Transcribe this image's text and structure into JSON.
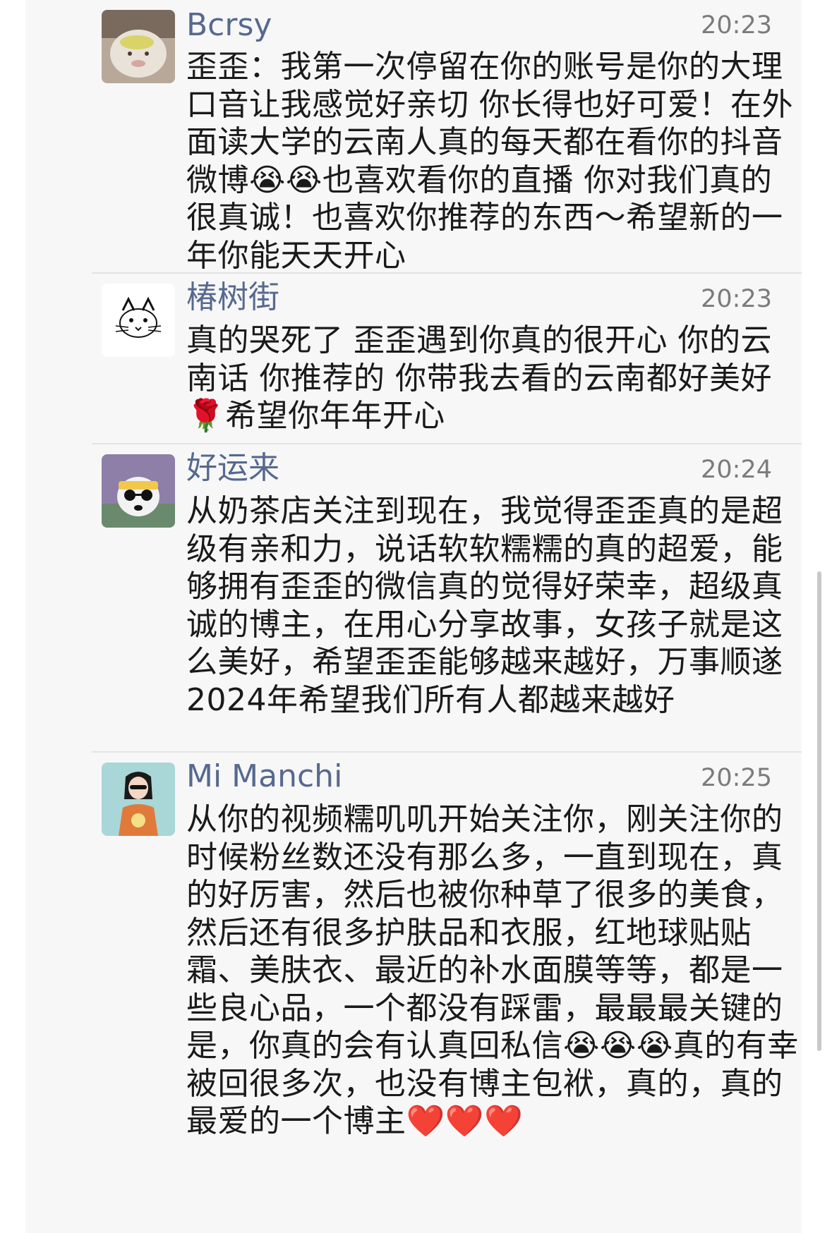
{
  "messages": [
    {
      "name": "Bcrsy",
      "time": "20:23",
      "text": "歪歪：我第一次停留在你的账号是你的大理口音让我感觉好亲切 你长得也好可爱！在外面读大学的云南人真的每天都在看你的抖音 微博😭😭也喜欢看你的直播 你对我们真的很真诚！也喜欢你推荐的东西～希望新的一年你能天天开心"
    },
    {
      "name": "椿树街",
      "time": "20:23",
      "text": "真的哭死了 歪歪遇到你真的很开心 你的云南话 你推荐的 你带我去看的云南都好美好🌹希望你年年开心"
    },
    {
      "name": "好运来",
      "time": "20:24",
      "text": "从奶茶店关注到现在，我觉得歪歪真的是超级有亲和力，说话软软糯糯的真的超爱，能够拥有歪歪的微信真的觉得好荣幸，超级真诚的博主，在用心分享故事，女孩子就是这么美好，希望歪歪能够越来越好，万事顺遂 2024年希望我们所有人都越来越好"
    },
    {
      "name": "Mi Manchi",
      "time": "20:25",
      "text": "从你的视频糯叽叽开始关注你，刚关注你的时候粉丝数还没有那么多，一直到现在，真的好厉害，然后也被你种草了很多的美食，然后还有很多护肤品和衣服，红地球贴贴霜、美肤衣、最近的补水面膜等等，都是一些良心品，一个都没有踩雷，最最最关键的是，你真的会有认真回私信😭😭😭真的有幸被回很多次，也没有博主包袱，真的，真的最爱的一个博主❤️❤️❤️"
    }
  ],
  "colors": {
    "name": "#56698f",
    "text": "#1a1a1a",
    "time": "#7b7b7b",
    "background": "#f7f7f7"
  }
}
